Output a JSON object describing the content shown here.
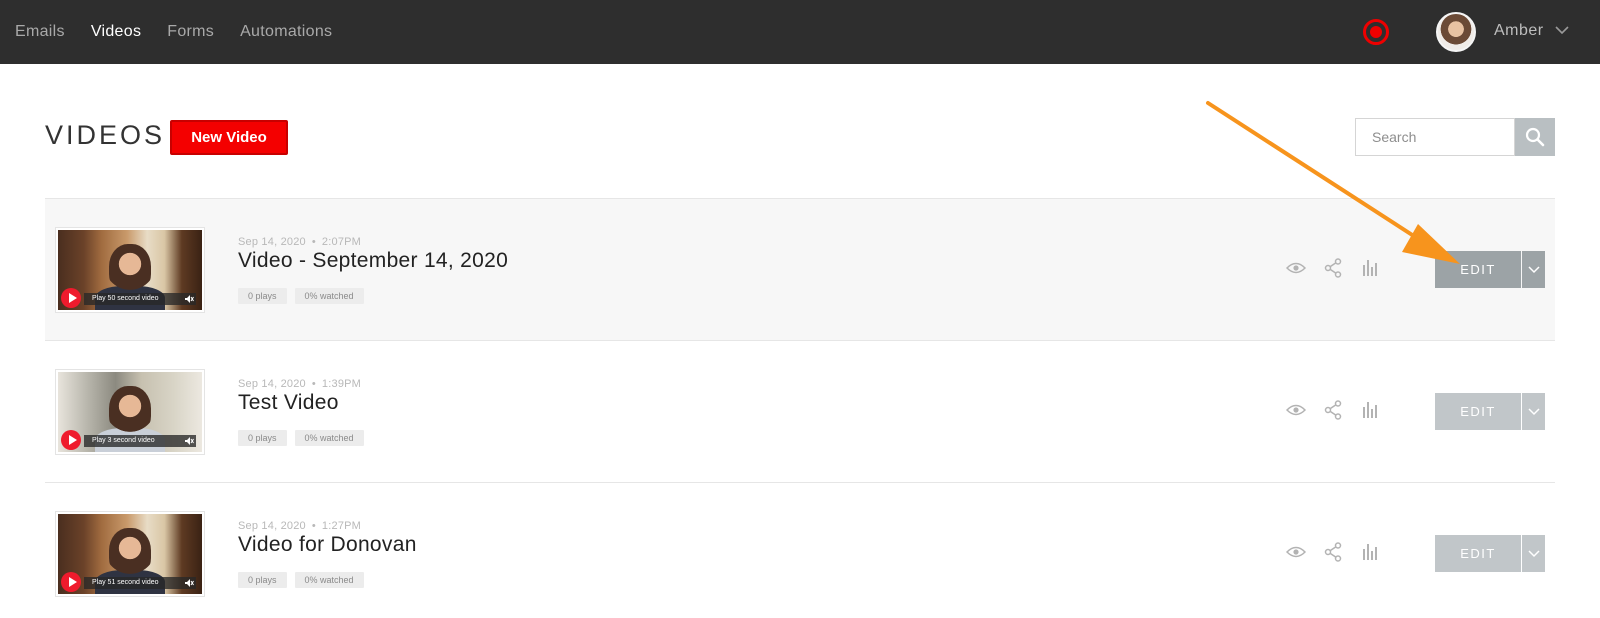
{
  "nav": {
    "items": [
      "Emails",
      "Videos",
      "Forms",
      "Automations"
    ],
    "active": "Videos"
  },
  "user": {
    "name": "Amber"
  },
  "header": {
    "title": "VIDEOS",
    "new_button": "New Video",
    "search_placeholder": "Search"
  },
  "videos": [
    {
      "date": "Sep 14, 2020",
      "time": "2:07PM",
      "title": "Video - September 14, 2020",
      "plays": "0 plays",
      "watched": "0% watched",
      "thumb_label": "Play 50 second video",
      "edit_label": "EDIT",
      "highlighted": true
    },
    {
      "date": "Sep 14, 2020",
      "time": "1:39PM",
      "title": "Test Video",
      "plays": "0 plays",
      "watched": "0% watched",
      "thumb_label": "Play 3 second video",
      "edit_label": "EDIT",
      "highlighted": false
    },
    {
      "date": "Sep 14, 2020",
      "time": "1:27PM",
      "title": "Video for Donovan",
      "plays": "0 plays",
      "watched": "0% watched",
      "thumb_label": "Play 51 second video",
      "edit_label": "EDIT",
      "highlighted": false
    }
  ],
  "colors": {
    "topbar": "#2e2e2e",
    "brand_red": "#f40000",
    "annotation_arrow": "#f7941d",
    "edit_button": "#c1c6c9",
    "edit_button_active": "#9ca3a6"
  },
  "icons": {
    "record": "record-icon",
    "preview": "eye-icon",
    "share": "share-icon",
    "stats": "bar-chart-icon",
    "search": "search-icon",
    "dropdown": "chevron-down-icon",
    "play": "play-icon",
    "mute": "mute-icon"
  }
}
